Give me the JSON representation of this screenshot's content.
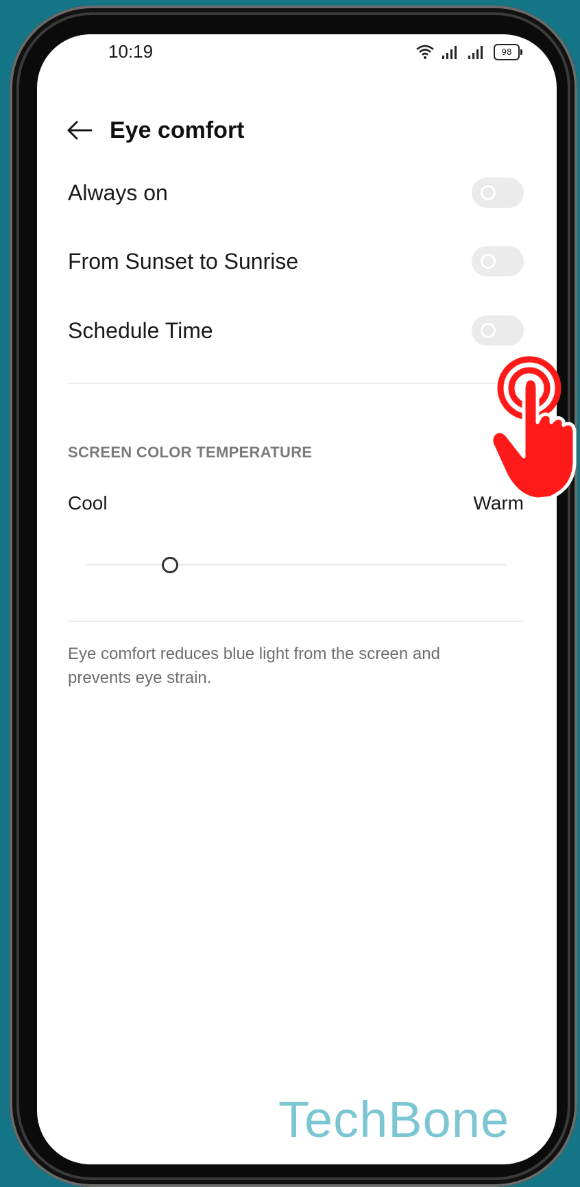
{
  "status_bar": {
    "time": "10:19",
    "battery": "98"
  },
  "header": {
    "title": "Eye comfort"
  },
  "settings": [
    {
      "label": "Always on",
      "enabled": false
    },
    {
      "label": "From Sunset to Sunrise",
      "enabled": false
    },
    {
      "label": "Schedule Time",
      "enabled": false
    }
  ],
  "color_temperature": {
    "section_title": "SCREEN COLOR TEMPERATURE",
    "left_label": "Cool",
    "right_label": "Warm",
    "value": 0.2
  },
  "description": "Eye comfort reduces blue light from the screen and prevents eye strain.",
  "watermark": "TechBone",
  "colors": {
    "background": "#137585",
    "tap_indicator": "#ff1a1a",
    "watermark": "#7cc6d4"
  }
}
